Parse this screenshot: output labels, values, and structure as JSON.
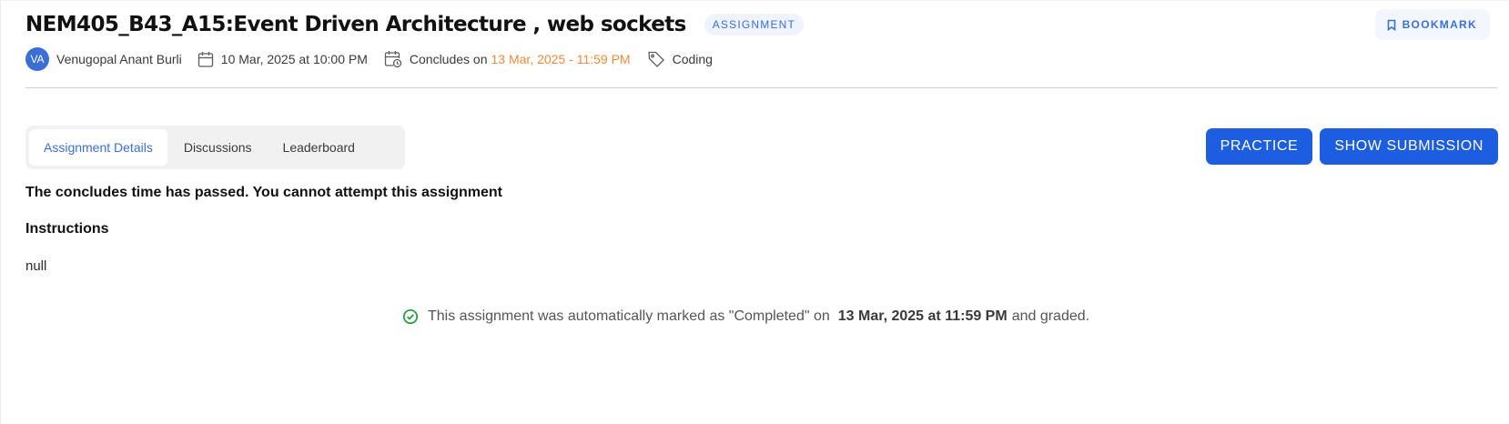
{
  "header": {
    "title": "NEM405_B43_A15:Event Driven Architecture , web sockets",
    "type_badge": "ASSIGNMENT",
    "bookmark_label": "BOOKMARK",
    "bookmark_icon": "bookmark-icon"
  },
  "meta": {
    "avatar_initials": "VA",
    "author": "Venugopal Anant Burli",
    "start_icon": "calendar-icon",
    "start_date": "10 Mar, 2025 at 10:00 PM",
    "concludes_icon": "calendar-clock-icon",
    "concludes_prefix": "Concludes on",
    "concludes_date": "13 Mar, 2025 - 11:59 PM",
    "tag_icon": "tag-icon",
    "tag": "Coding"
  },
  "tabs": [
    {
      "label": "Assignment Details",
      "active": true
    },
    {
      "label": "Discussions",
      "active": false
    },
    {
      "label": "Leaderboard",
      "active": false
    }
  ],
  "actions": {
    "practice_label": "PRACTICE",
    "show_submission_label": "SHOW SUBMISSION"
  },
  "content": {
    "notice": "The concludes time has passed. You cannot attempt this assignment",
    "instructions_title": "Instructions",
    "instructions_body": "null"
  },
  "status": {
    "icon": "check-circle-icon",
    "text_before": "This assignment was automatically marked as \"Completed\" on",
    "completed_at": "13 Mar, 2025 at 11:59 PM",
    "text_after": "and graded."
  },
  "colors": {
    "primary": "#1d5ee0",
    "accent_orange": "#f28a3a",
    "success_green": "#1f9d3a"
  }
}
